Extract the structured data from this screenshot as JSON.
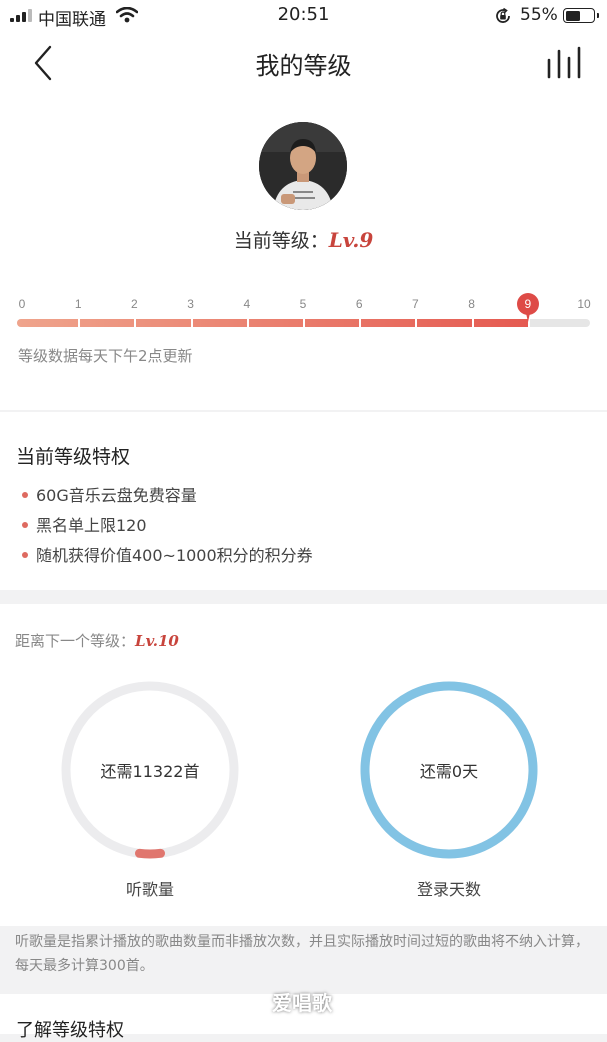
{
  "status_bar": {
    "carrier": "中国联通",
    "time": "20:51",
    "battery": "55%",
    "battery_level": 0.55
  },
  "nav": {
    "title": "我的等级",
    "back_icon": "chevron-left-icon",
    "chart_icon": "bar-chart-icon"
  },
  "level_card": {
    "current_prefix": "当前等级：",
    "current_level": "Lv.9",
    "ticks": [
      "0",
      "1",
      "2",
      "3",
      "4",
      "5",
      "6",
      "7",
      "8",
      "9",
      "10"
    ],
    "current_value": 9,
    "update_note": "等级数据每天下午2点更新",
    "colors": {
      "accent": "#de4b47",
      "track": "#e6e6e6"
    }
  },
  "privileges": {
    "title": "当前等级特权",
    "items": [
      "60G音乐云盘免费容量",
      "黑名单上限120",
      "随机获得价值400~1000积分的积分券"
    ]
  },
  "next_level": {
    "prefix": "距离下一个等级：",
    "level": "Lv.10",
    "songs": {
      "text": "还需11322首",
      "label": "听歌量",
      "progress": 0.04,
      "color": "#e0766e"
    },
    "days": {
      "text": "还需0天",
      "label": "登录天数",
      "progress": 1.0,
      "color": "#82c3e4"
    }
  },
  "footnote": "听歌量是指累计播放的歌曲数量而非播放次数，并且实际播放时间过短的歌曲将不纳入计算，每天最多计算300首。",
  "bottom_section": {
    "title": "了解等级特权"
  },
  "watermark": "爱唱歌"
}
